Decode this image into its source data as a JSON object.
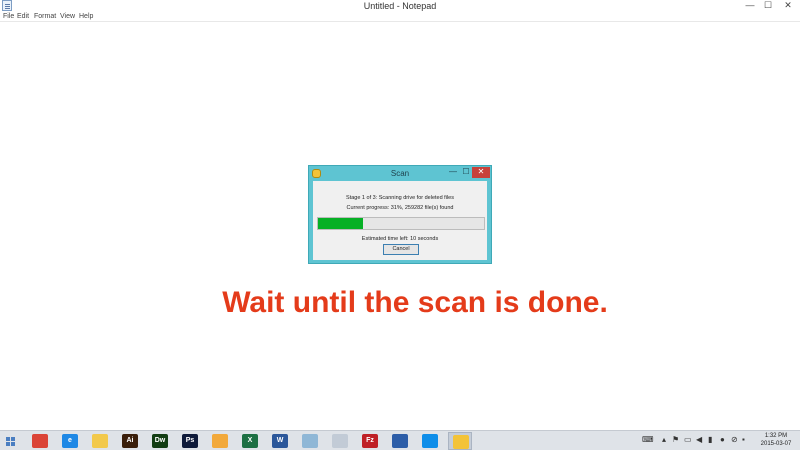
{
  "notepad": {
    "title": "Untitled - Notepad",
    "controls": {
      "minimize": "—",
      "maximize": "☐",
      "close": "✕"
    },
    "menu": [
      "File",
      "Edit",
      "Format",
      "View",
      "Help"
    ]
  },
  "scan_dialog": {
    "title": "Scan",
    "controls": {
      "minimize": "—",
      "maximize": "☐",
      "close": "✕"
    },
    "stage_text": "Stage 1 of 3: Scanning drive for deleted files",
    "progress_text": "Current progress: 31%, 259282 file(s) found",
    "progress_value": 0.27,
    "progress_color": "#06b025",
    "eta_text": "Estimated time left: 10 seconds",
    "cancel_label": "Cancel"
  },
  "caption": {
    "text": "Wait until the scan is done.",
    "color": "#e43b1a"
  },
  "taskbar": {
    "apps": [
      {
        "name": "chrome-icon",
        "label": "",
        "color": "#db4437"
      },
      {
        "name": "internet-explorer-icon",
        "label": "e",
        "color": "#1e88e5"
      },
      {
        "name": "file-explorer-icon",
        "label": "",
        "color": "#f2c94c"
      },
      {
        "name": "illustrator-icon",
        "label": "Ai",
        "color": "#3a1e0a"
      },
      {
        "name": "dreamweaver-icon",
        "label": "Dw",
        "color": "#123d13"
      },
      {
        "name": "photoshop-icon",
        "label": "Ps",
        "color": "#0e1a3a"
      },
      {
        "name": "outlook-icon",
        "label": "",
        "color": "#f2a93b"
      },
      {
        "name": "excel-icon",
        "label": "X",
        "color": "#1d7044"
      },
      {
        "name": "word-icon",
        "label": "W",
        "color": "#2b579a"
      },
      {
        "name": "notepad-taskbar-icon",
        "label": "",
        "color": "#8fb7d6"
      },
      {
        "name": "document-icon",
        "label": "",
        "color": "#c2cbd6"
      },
      {
        "name": "filezilla-icon",
        "label": "Fz",
        "color": "#bf2026"
      },
      {
        "name": "remote-desktop-icon",
        "label": "",
        "color": "#2d5ea8"
      },
      {
        "name": "teamviewer-icon",
        "label": "",
        "color": "#0e8ee9"
      },
      {
        "name": "scan-app-icon",
        "label": "",
        "color": "#f3c338"
      }
    ],
    "clock_time": "1:32 PM",
    "clock_date": "2015-03-07"
  }
}
